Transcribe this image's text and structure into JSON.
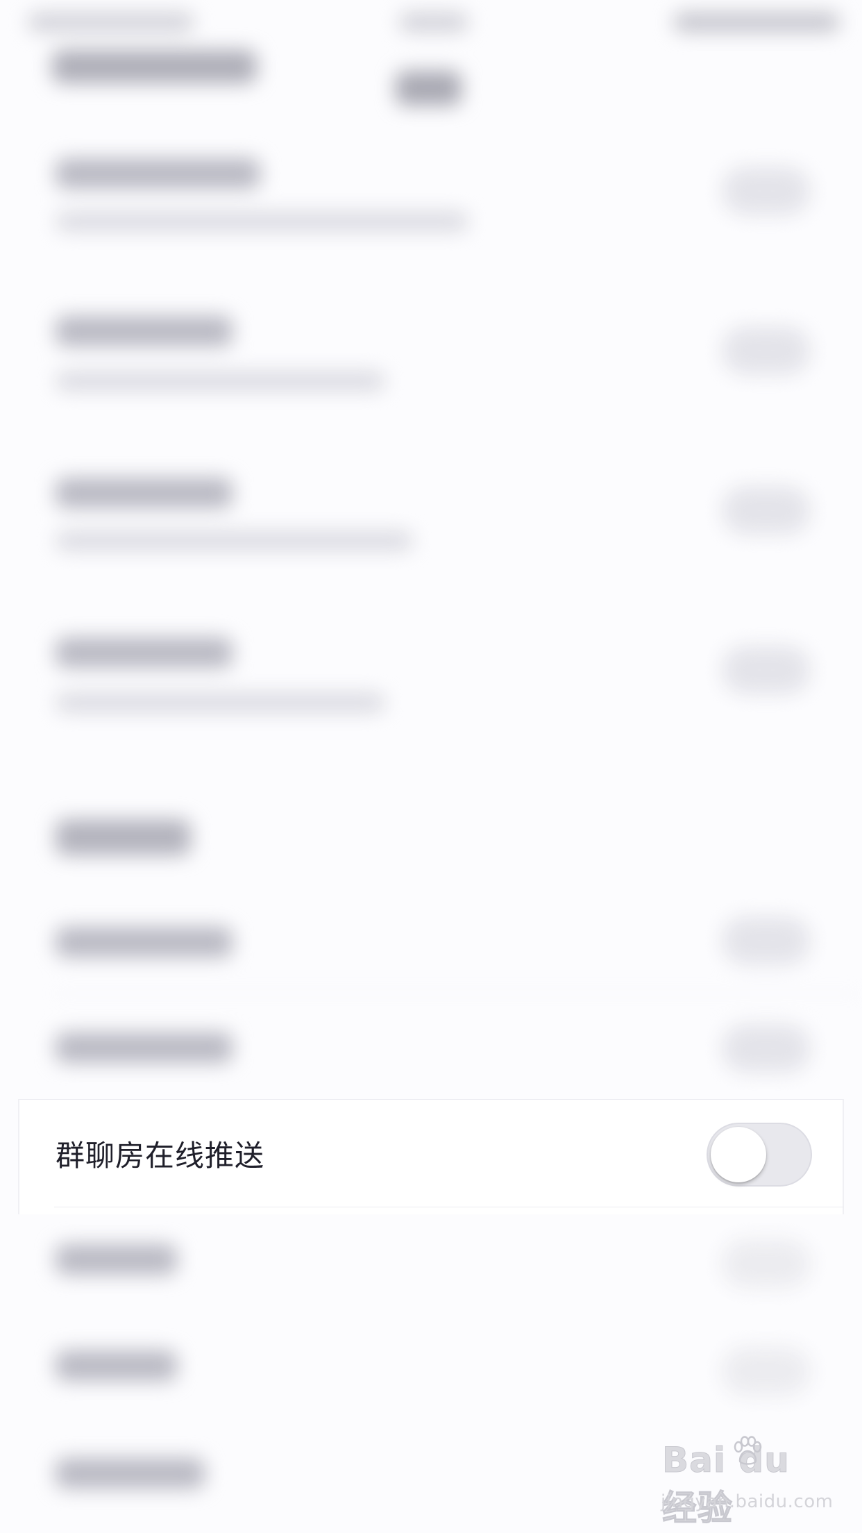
{
  "settings": {
    "focused_row": {
      "label": "群聊房在线推送",
      "toggle_on": false
    }
  },
  "colors": {
    "background": "#fcfcfe",
    "card_background": "#ffffff",
    "toggle_track_off": "#e8e8ed",
    "text_primary": "#1f1f2a"
  },
  "watermark": {
    "logo": "Bai du 经验",
    "url": "jingyan.baidu.com"
  }
}
